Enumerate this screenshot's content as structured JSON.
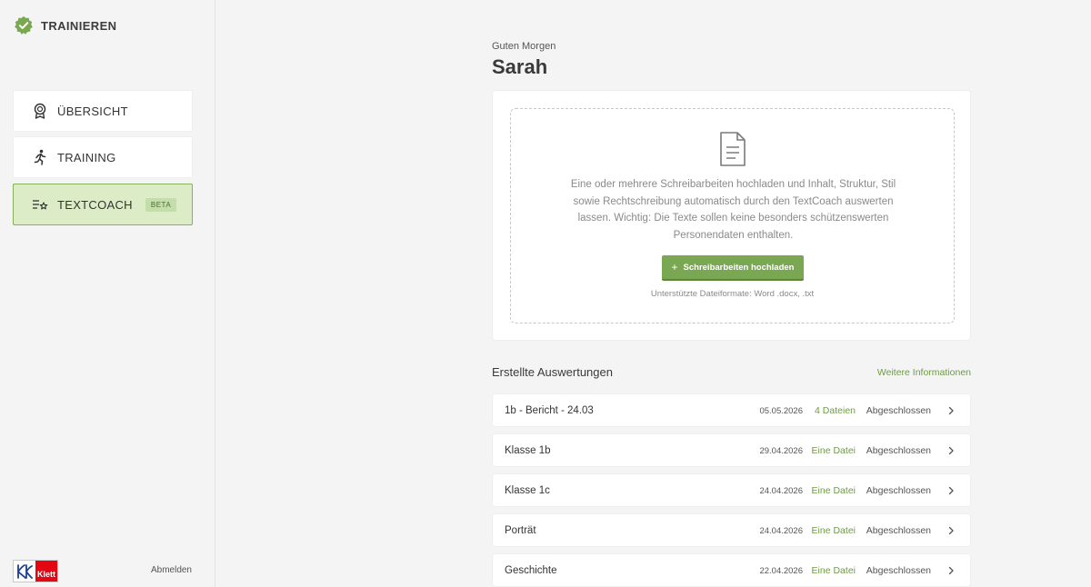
{
  "sidebar": {
    "brand_title": "TRAINIEREN",
    "brand_icon": "check-badge-icon",
    "items": [
      {
        "label": "ÜBERSICHT",
        "icon": "medal-icon",
        "active": false
      },
      {
        "label": "TRAINING",
        "icon": "running-person-icon",
        "active": false
      },
      {
        "label": "TEXTCOACH",
        "icon": "list-star-icon",
        "active": true,
        "badge": "BETA"
      }
    ],
    "logo_text": "Klett",
    "logout_label": "Abmelden"
  },
  "header": {
    "greeting": "Guten Morgen",
    "user_name": "Sarah"
  },
  "upload": {
    "description": "Eine oder mehrere Schreibarbeiten hochladen und Inhalt, Struktur, Stil sowie Rechtschreibung automatisch durch den TextCoach auswerten lassen. Wichtig: Die Texte sollen keine besonders schützenswerten Personendaten enthalten.",
    "button_label": "Schreibarbeiten hochladen",
    "button_icon": "plus-icon",
    "formats": "Unterstützte Dateiformate: Word .docx, .txt"
  },
  "evaluations": {
    "title": "Erstellte Auswertungen",
    "more_info": "Weitere Informationen",
    "rows": [
      {
        "name": "1b - Bericht - 24.03",
        "date": "05.05.2026",
        "files": "4 Dateien",
        "status": "Abgeschlossen"
      },
      {
        "name": "Klasse 1b",
        "date": "29.04.2026",
        "files": "Eine Datei",
        "status": "Abgeschlossen"
      },
      {
        "name": "Klasse 1c",
        "date": "24.04.2026",
        "files": "Eine Datei",
        "status": "Abgeschlossen"
      },
      {
        "name": "Porträt",
        "date": "24.04.2026",
        "files": "Eine Datei",
        "status": "Abgeschlossen"
      },
      {
        "name": "Geschichte",
        "date": "22.04.2026",
        "files": "Eine Datei",
        "status": "Abgeschlossen"
      }
    ]
  },
  "colors": {
    "accent": "#7aa752",
    "accent_text": "#6f9a45",
    "active_bg": "#dbecc7",
    "background": "#f4f4f4"
  }
}
